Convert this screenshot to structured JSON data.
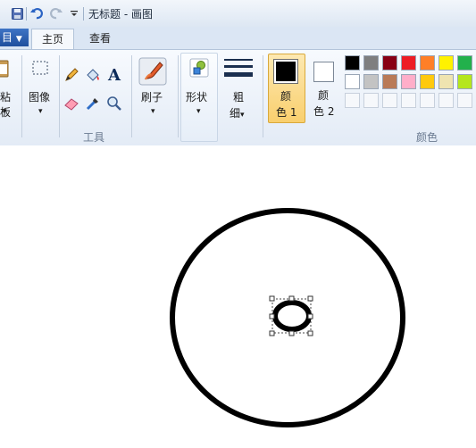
{
  "window": {
    "title": "无标题 - 画图"
  },
  "quick_access": {
    "save_icon": "save-icon",
    "undo_icon": "undo-icon",
    "redo_icon": "redo-icon",
    "customize_icon": "dropdown-arrow-icon"
  },
  "tabs": {
    "file_label": "目",
    "home_label": "主页",
    "view_label": "查看"
  },
  "ribbon": {
    "clipboard_label": "粘板",
    "image_label": "图像",
    "tools_group_label": "工具",
    "brush_label": "刷子",
    "shapes_label": "形状",
    "size_label_1": "粗",
    "size_label_2": "细",
    "color1_label_1": "颜",
    "color1_label_2": "色 1",
    "color2_label_1": "颜",
    "color2_label_2": "色 2",
    "colors_group_label": "颜色",
    "color1_value": "#000000",
    "color2_value": "#ffffff",
    "palette_row1": [
      "#000000",
      "#7f7f7f",
      "#880015",
      "#ed1c24",
      "#ff7f27",
      "#fff200",
      "#22b14c"
    ],
    "palette_row2": [
      "#ffffff",
      "#c3c3c3",
      "#b97a57",
      "#ffaec9",
      "#ffc90e",
      "#efe4b0",
      "#b5e61d"
    ]
  }
}
